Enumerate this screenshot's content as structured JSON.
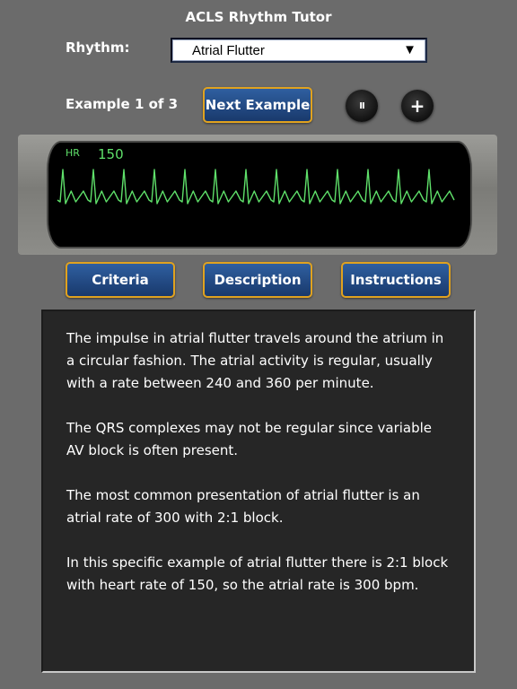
{
  "app": {
    "title": "ACLS Rhythm Tutor"
  },
  "rhythm": {
    "label": "Rhythm:",
    "selected": "Atrial Flutter",
    "arrow": "▼"
  },
  "example": {
    "label": "Example 1 of 3",
    "next_label": "Next Example"
  },
  "controls": {
    "pause_glyph": "II",
    "add_glyph": "+"
  },
  "monitor": {
    "hr_label": "HR",
    "hr_value": "150",
    "trace_color": "#5fe06a",
    "beats": 13
  },
  "tabs": [
    {
      "label": "Criteria"
    },
    {
      "label": "Description"
    },
    {
      "label": "Instructions"
    }
  ],
  "description": {
    "paragraphs": [
      "The impulse in atrial flutter travels around the atrium in a circular fashion. The atrial activity is regular, usually with a rate between 240 and 360 per minute.",
      "The QRS complexes may not be regular since variable AV block is often present.",
      "The most common presentation of atrial flutter is an atrial rate of 300 with 2:1 block.",
      "In this specific example of atrial flutter there is 2:1 block with heart rate of 150, so the atrial rate is 300 bpm."
    ]
  },
  "colors": {
    "accent_border": "#e0a21f",
    "button_blue": "#2f5fa0",
    "background": "#6b6b6b"
  }
}
